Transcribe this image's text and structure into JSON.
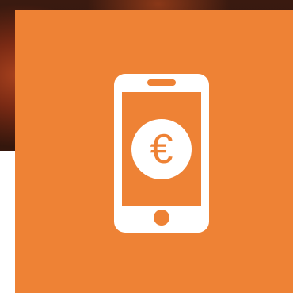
{
  "colors": {
    "tile": "#ee8235",
    "icon": "#ffffff",
    "background": "#ffffff",
    "photo_dark": "#2c130b",
    "photo_accent": "#a8421e"
  },
  "icon": {
    "name": "mobile-phone-euro-icon",
    "symbol": "€"
  }
}
